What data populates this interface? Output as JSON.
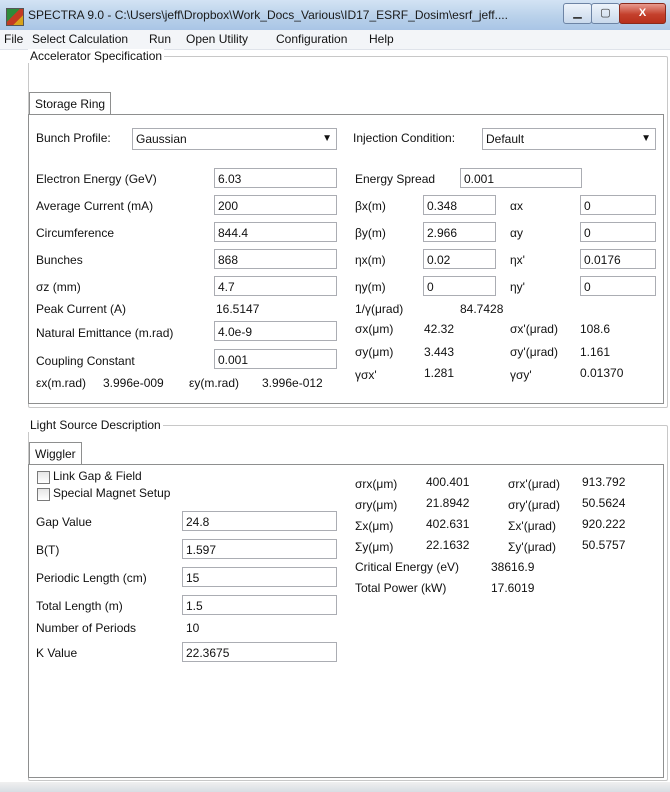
{
  "window": {
    "title": "SPECTRA 9.0 - C:\\Users\\jeff\\Dropbox\\Work_Docs_Various\\ID17_ESRF_Dosim\\esrf_jeff....",
    "close_glyph": "X"
  },
  "menu": [
    "File",
    "Select Calculation",
    "Run",
    "Open Utility",
    "Configuration",
    "Help"
  ],
  "accelerator": {
    "group_label": "Accelerator Specification",
    "tab": "Storage Ring",
    "bunch_profile_label": "Bunch Profile:",
    "bunch_profile_value": "Gaussian",
    "injection_label": "Injection Condition:",
    "injection_value": "Default",
    "left_fields": [
      {
        "label": "Electron Energy (GeV)",
        "value": "6.03"
      },
      {
        "label": "Average Current (mA)",
        "value": "200"
      },
      {
        "label": "Circumference",
        "value": "844.4"
      },
      {
        "label": "Bunches",
        "value": "868"
      },
      {
        "label": "σz (mm)",
        "value": "4.7"
      }
    ],
    "peak_current_label": "Peak Current (A)",
    "peak_current_value": "16.5147",
    "emittance_label": "Natural Emittance (m.rad)",
    "emittance_value": "4.0e-9",
    "coupling_label": "Coupling Constant",
    "coupling_value": "0.001",
    "eps_x_label": "εx(m.rad)",
    "eps_x_value": "3.996e-009",
    "eps_y_label": "εy(m.rad)",
    "eps_y_value": "3.996e-012",
    "energy_spread_label": "Energy Spread",
    "energy_spread_value": "0.001",
    "optics": [
      {
        "l1": "βx(m)",
        "v1": "0.348",
        "l2": "αx",
        "v2": "0"
      },
      {
        "l1": "βy(m)",
        "v1": "2.966",
        "l2": "αy",
        "v2": "0"
      },
      {
        "l1": "ηx(m)",
        "v1": "0.02",
        "l2": "ηx'",
        "v2": "0.0176"
      },
      {
        "l1": "ηy(m)",
        "v1": "0",
        "l2": "ηy'",
        "v2": "0"
      }
    ],
    "gamma_inv_label": "1/γ(μrad)",
    "gamma_inv_value": "84.7428",
    "beam": [
      {
        "l1": "σx(μm)",
        "v1": "42.32",
        "l2": "σx'(μrad)",
        "v2": "108.6"
      },
      {
        "l1": "σy(μm)",
        "v1": "3.443",
        "l2": "σy'(μrad)",
        "v2": "1.161"
      },
      {
        "l1": "γσx'",
        "v1": "1.281",
        "l2": "γσy'",
        "v2": "0.01370"
      }
    ]
  },
  "light_source": {
    "group_label": "Light Source Description",
    "tab": "Wiggler",
    "link_gap_label": "Link Gap & Field",
    "special_magnet_label": "Special Magnet Setup",
    "fields": [
      {
        "label": "Gap Value",
        "value": "24.8"
      },
      {
        "label": "B(T)",
        "value": "1.597"
      },
      {
        "label": "Periodic Length (cm)",
        "value": "15"
      },
      {
        "label": "Total Length (m)",
        "value": "1.5"
      }
    ],
    "periods_label": "Number of Periods",
    "periods_value": "10",
    "k_label": "K Value",
    "k_value": "22.3675",
    "results": [
      {
        "l1": "σrx(μm)",
        "v1": "400.401",
        "l2": "σrx'(μrad)",
        "v2": "913.792"
      },
      {
        "l1": "σry(μm)",
        "v1": "21.8942",
        "l2": "σry'(μrad)",
        "v2": "50.5624"
      },
      {
        "l1": "Σx(μm)",
        "v1": "402.631",
        "l2": "Σx'(μrad)",
        "v2": "920.222"
      },
      {
        "l1": "Σy(μm)",
        "v1": "22.1632",
        "l2": "Σy'(μrad)",
        "v2": "50.5757"
      }
    ],
    "critical_energy_label": "Critical Energy (eV)",
    "critical_energy_value": "38616.9",
    "total_power_label": "Total Power (kW)",
    "total_power_value": "17.6019"
  }
}
